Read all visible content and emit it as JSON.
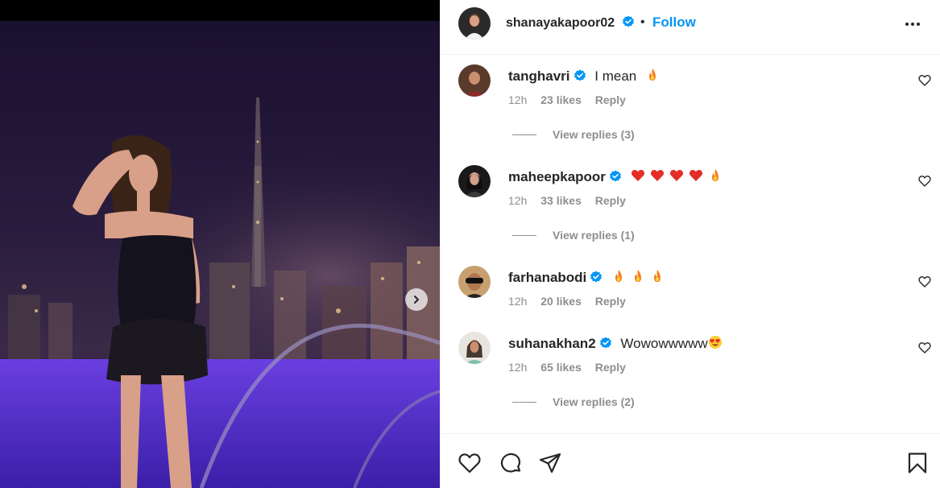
{
  "post": {
    "author": "shanayakapoor02",
    "follow_label": "Follow",
    "separator": "•"
  },
  "comments": [
    {
      "username": "tanghavri",
      "text": "I mean",
      "emojis": [
        "fire"
      ],
      "time": "12h",
      "likes": "23 likes",
      "reply_label": "Reply",
      "view_replies": "View replies (3)"
    },
    {
      "username": "maheepkapoor",
      "text": "",
      "emojis": [
        "red-heart",
        "red-heart",
        "red-heart",
        "red-heart",
        "fire"
      ],
      "time": "12h",
      "likes": "33 likes",
      "reply_label": "Reply",
      "view_replies": "View replies (1)"
    },
    {
      "username": "farhanabodi",
      "text": "",
      "emojis": [
        "fire",
        "fire",
        "fire"
      ],
      "time": "12h",
      "likes": "20 likes",
      "reply_label": "Reply",
      "view_replies": ""
    },
    {
      "username": "suhanakhan2",
      "text": "Wowowwwww",
      "emojis": [
        "heart-eyes"
      ],
      "time": "12h",
      "likes": "65 likes",
      "reply_label": "Reply",
      "view_replies": "View replies (2)"
    }
  ],
  "icons": {
    "like": "heart-icon",
    "comment": "comment-icon",
    "share": "share-icon",
    "save": "bookmark-icon",
    "more": "more-options-icon",
    "next": "chevron-right-icon"
  },
  "colors": {
    "accent": "#0095f6",
    "verified": "#0095f6",
    "muted": "#8e8e8e",
    "text": "#262626"
  }
}
